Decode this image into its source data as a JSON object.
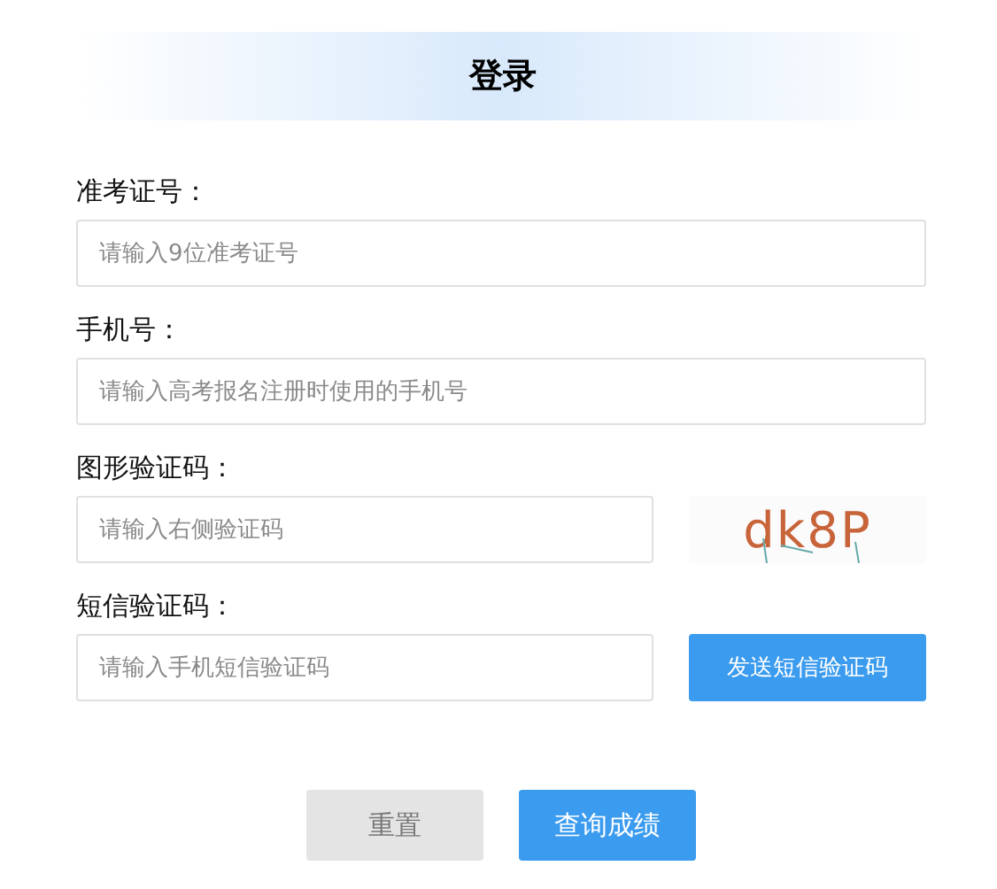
{
  "title": "登录",
  "fields": [
    {
      "kind": "plain",
      "label": "准考证号：",
      "placeholder": "请输入9位准考证号"
    },
    {
      "kind": "plain",
      "label": "手机号：",
      "placeholder": "请输入高考报名注册时使用的手机号"
    },
    {
      "kind": "captcha",
      "label": "图形验证码：",
      "placeholder": "请输入右侧验证码",
      "captcha_text": "dk8P"
    },
    {
      "kind": "sms",
      "label": "短信验证码：",
      "placeholder": "请输入手机短信验证码",
      "button": "发送短信验证码"
    }
  ],
  "buttons": [
    {
      "kind": "reset",
      "label": "重置"
    },
    {
      "kind": "submit",
      "label": "查询成绩"
    }
  ]
}
